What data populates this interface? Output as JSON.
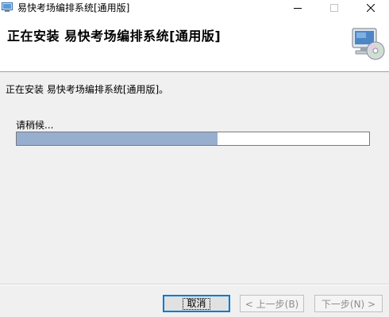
{
  "window": {
    "title": "易快考场编排系统[通用版]",
    "icons": {
      "app": "installer-app-icon",
      "minimize": "minimize-icon",
      "maximize": "maximize-icon",
      "close": "close-icon"
    }
  },
  "header": {
    "title": "正在安装 易快考场编排系统[通用版]",
    "icon": "computer-cd-icon"
  },
  "body": {
    "status_message": "正在安装 易快考场编排系统[通用版]。",
    "wait_label": "请稍候...",
    "progress_fraction": 0.57
  },
  "buttons": {
    "cancel": "取消",
    "back": "< 上一步(B)",
    "next": "下一步(N) >"
  },
  "colors": {
    "progress_fill": "#97aecf",
    "focus_border": "#0078d7",
    "disabled_text": "#8d8d8d"
  }
}
